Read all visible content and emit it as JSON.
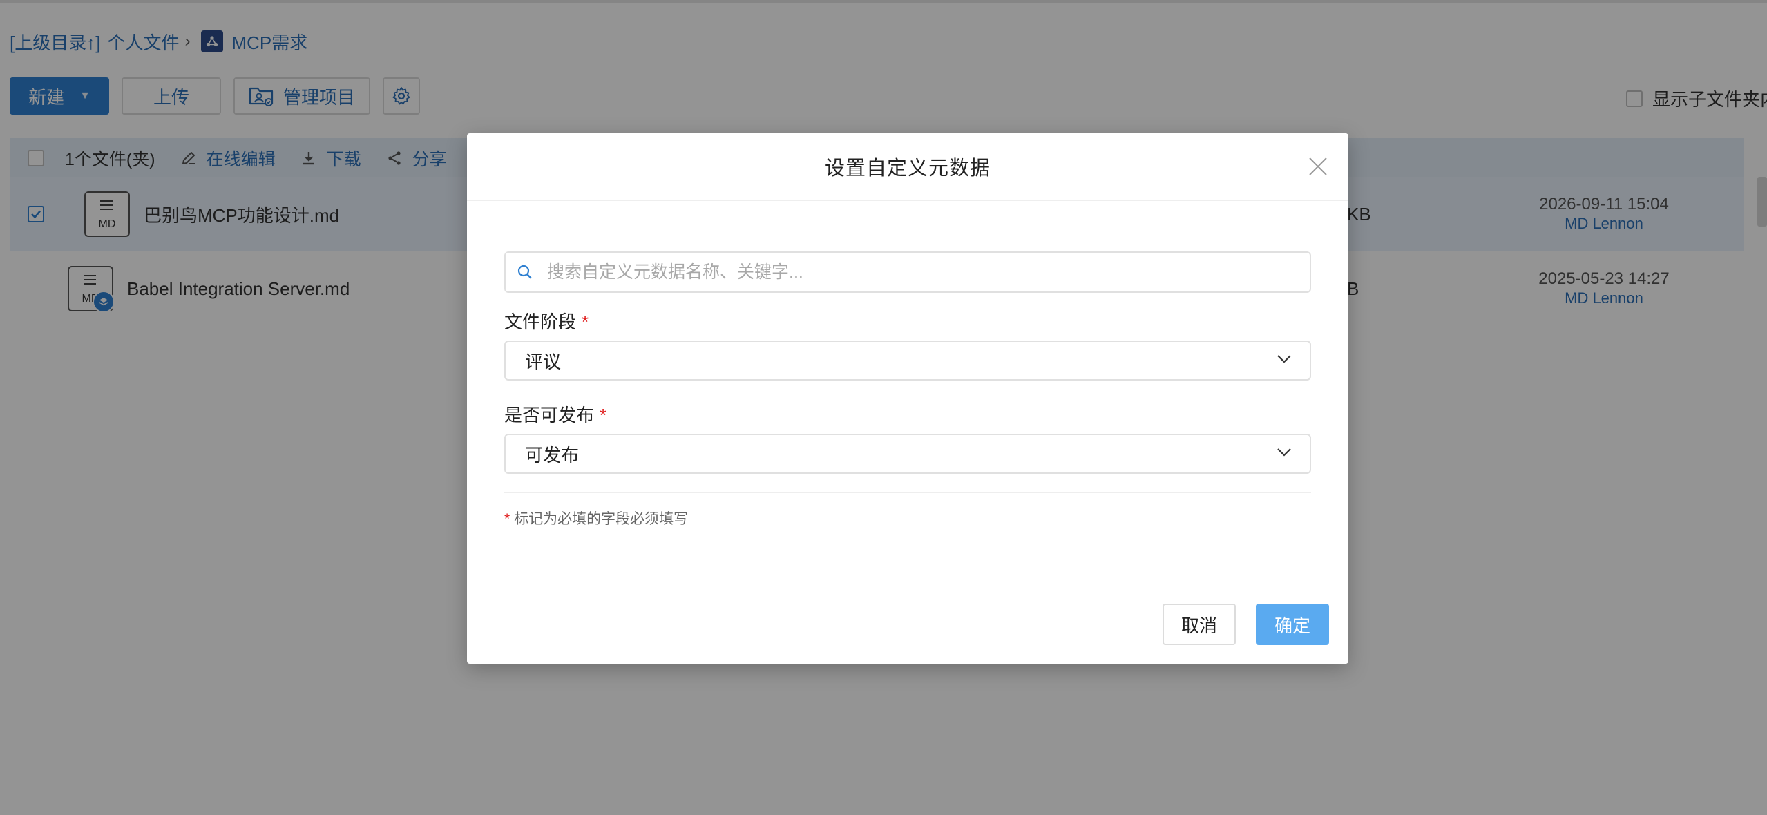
{
  "breadcrumb": {
    "up_link": "[上级目录↑]",
    "personal_files": "个人文件",
    "separator": "›",
    "project_name": "MCP需求"
  },
  "toolbar": {
    "new_label": "新建",
    "upload_label": "上传",
    "manage_label": "管理项目",
    "show_subfolders_label": "显示子文件夹内"
  },
  "list_header": {
    "selection_count": "1个文件(夹)",
    "actions": {
      "edit_online": "在线编辑",
      "download": "下载",
      "share": "分享"
    }
  },
  "files": [
    {
      "name": "巴别鸟MCP功能设计.md",
      "ext": "MD",
      "size": "KB",
      "date": "2026-09-11 15:04",
      "owner": "MD Lennon",
      "selected": true
    },
    {
      "name": "Babel Integration Server.md",
      "ext": "MD",
      "size": "B",
      "date": "2025-05-23 14:27",
      "owner": "MD Lennon",
      "selected": false
    }
  ],
  "modal": {
    "title": "设置自定义元数据",
    "search_placeholder": "搜索自定义元数据名称、关键字...",
    "fields": [
      {
        "label": "文件阶段",
        "required_mark": "*",
        "value": "评议"
      },
      {
        "label": "是否可发布",
        "required_mark": "*",
        "value": "可发布"
      }
    ],
    "required_note_mark": "*",
    "required_note": "标记为必填的字段必须填写",
    "cancel_label": "取消",
    "ok_label": "确定"
  },
  "colors": {
    "accent": "#2f80d1",
    "link": "#2c6fb7",
    "confirm_button": "#5aaaf0",
    "required": "#e02020",
    "overlay": "rgba(0,0,0,0.42)"
  },
  "icons": {
    "project": "project-icon",
    "manage": "folder-user-icon",
    "settings": "gear-icon",
    "edit": "pencil-icon",
    "download": "download-icon",
    "share": "share-icon",
    "search": "search-icon",
    "close": "close-icon",
    "dropdown": "chevron-down-icon"
  }
}
